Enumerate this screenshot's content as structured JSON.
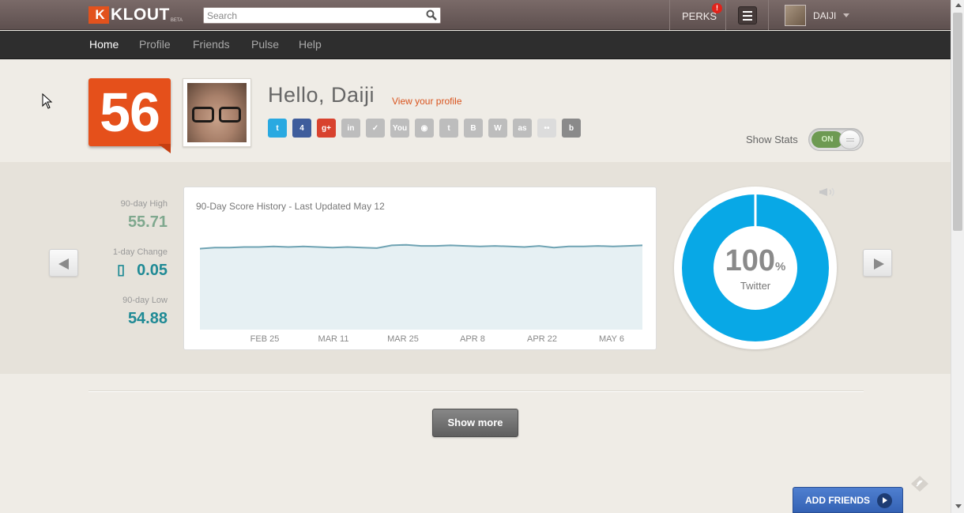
{
  "topbar": {
    "logo_mark": "K",
    "logo_text": "KLOUT",
    "logo_beta": "BETA",
    "search_placeholder": "Search",
    "perks_label": "PERKS",
    "perks_badge": "!",
    "user_name": "DAIJI"
  },
  "nav": {
    "items": [
      {
        "label": "Home",
        "active": true
      },
      {
        "label": "Profile",
        "active": false
      },
      {
        "label": "Friends",
        "active": false
      },
      {
        "label": "Pulse",
        "active": false
      },
      {
        "label": "Help",
        "active": false
      }
    ]
  },
  "header": {
    "score": "56",
    "greeting": "Hello, Daiji",
    "view_profile_link": "View your profile",
    "networks": [
      {
        "icon": "twitter-icon",
        "glyph": "t",
        "color": "#29a9e1"
      },
      {
        "icon": "foursquare-icon",
        "glyph": "4",
        "color": "#3f5d9c"
      },
      {
        "icon": "google-plus-icon",
        "glyph": "g+",
        "color": "#d8422e"
      },
      {
        "icon": "linkedin-icon",
        "glyph": "in",
        "color": "#bdbdbd"
      },
      {
        "icon": "check-icon",
        "glyph": "✓",
        "color": "#bdbdbd"
      },
      {
        "icon": "youtube-icon",
        "glyph": "You",
        "color": "#bdbdbd"
      },
      {
        "icon": "instagram-icon",
        "glyph": "◉",
        "color": "#bdbdbd"
      },
      {
        "icon": "tumblr-icon",
        "glyph": "t",
        "color": "#bdbdbd"
      },
      {
        "icon": "blogger-icon",
        "glyph": "B",
        "color": "#bdbdbd"
      },
      {
        "icon": "wordpress-icon",
        "glyph": "W",
        "color": "#bdbdbd"
      },
      {
        "icon": "lastfm-icon",
        "glyph": "as",
        "color": "#bdbdbd"
      },
      {
        "icon": "flickr-icon",
        "glyph": "••",
        "color": "#dcdcdc"
      },
      {
        "icon": "bing-icon",
        "glyph": "b",
        "color": "#8a8a8a"
      }
    ],
    "show_stats_label": "Show Stats",
    "toggle_state": "ON"
  },
  "stats": {
    "high_label": "90-day High",
    "high_value": "55.71",
    "change_label": "1-day Change",
    "change_icon": "▯",
    "change_value": "0.05",
    "low_label": "90-day Low",
    "low_value": "54.88",
    "colors": {
      "high": "#7fa88e",
      "change": "#1f8a95",
      "low": "#1f8a95"
    }
  },
  "chart_data": {
    "type": "area",
    "title": "90-Day Score History - Last Updated May 12",
    "x_tick_labels": [
      "FEB 25",
      "MAR 11",
      "MAR 25",
      "APR 8",
      "APR 22",
      "MAY 6"
    ],
    "values": [
      54.9,
      55.1,
      55.1,
      55.2,
      55.2,
      55.3,
      55.2,
      55.3,
      55.2,
      55.1,
      55.2,
      55.1,
      55.0,
      55.5,
      55.6,
      55.4,
      55.4,
      55.5,
      55.4,
      55.3,
      55.4,
      55.3,
      55.2,
      55.4,
      55.1,
      55.3,
      55.3,
      55.4,
      55.3,
      55.4,
      55.5
    ],
    "ylim": [
      40,
      56
    ],
    "line_color": "#6fa3b3",
    "fill_color": "#e6f0f3"
  },
  "donut": {
    "value": "100",
    "unit": "%",
    "label": "Twitter",
    "fraction": 1.0,
    "color": "#08a8e6"
  },
  "footer": {
    "show_more": "Show more",
    "add_friends": "ADD FRIENDS"
  }
}
